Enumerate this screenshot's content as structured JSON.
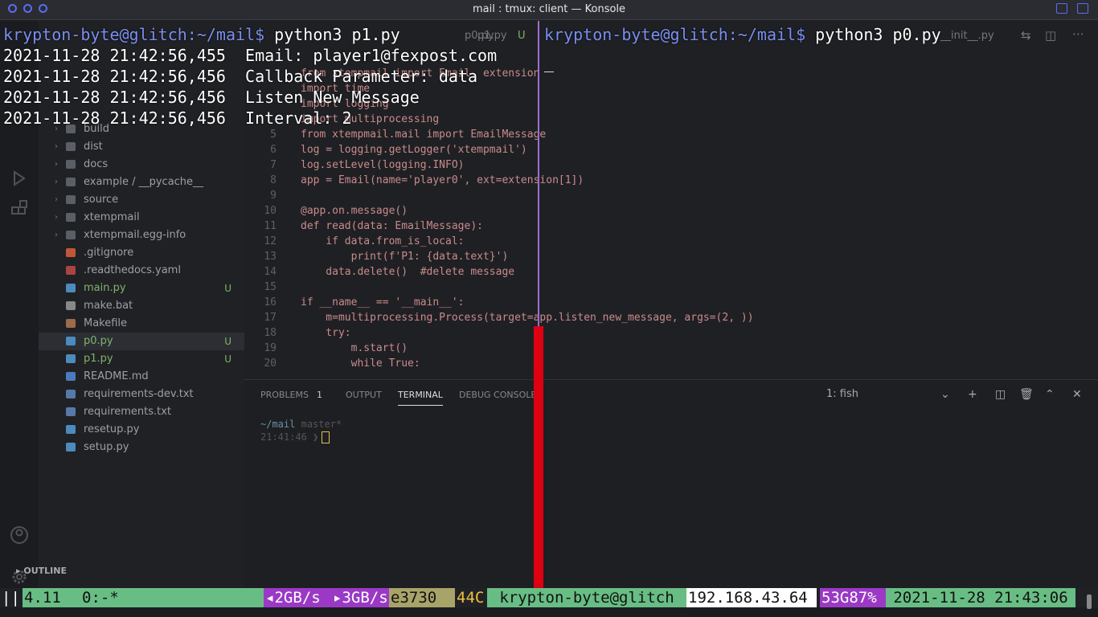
{
  "window": {
    "title": "mail : tmux: client — Konsole"
  },
  "colors": {
    "divider": "#9b6fd0",
    "status_green": "#68bd84",
    "status_purple": "#9b39c6",
    "status_khaki": "#a8a368",
    "status_white": "#ffffff",
    "cpu_temp_text": "#f0c040",
    "alert_red": "#dd0011"
  },
  "left_pane": {
    "prompt_user": "krypton-byte@glitch",
    "prompt_path": ":~/mail$",
    "command": " python3 p1.py",
    "logs": [
      {
        "timestamp": "2021-11-28 21:42:56,455",
        "message": "Email: player1@fexpost.com"
      },
      {
        "timestamp": "2021-11-28 21:42:56,456",
        "message": "Callback Parameter: data"
      },
      {
        "timestamp": "2021-11-28 21:42:56,456",
        "message": "Listen New Message"
      },
      {
        "timestamp": "2021-11-28 21:42:56,456",
        "message": "Interval: 2"
      }
    ]
  },
  "right_pane": {
    "prompt_user": "krypton-byte@glitch",
    "prompt_path": ":~/mail$",
    "command": " python3 p0.py",
    "cursor": "_"
  },
  "status_bar": {
    "session": "||",
    "version": "4.11",
    "window": "0:-*",
    "download": "◂2GB/s",
    "upload": "▸3GB/s",
    "cpu_model": "e3730",
    "cpu_temp": "44C",
    "host": "krypton-byte@glitch",
    "ip": "192.168.43.64",
    "mem": "53G87%",
    "datetime": "2021-11-28 21:43:06"
  },
  "vscode": {
    "editor_tabs": [
      "p0.py",
      "p1.py",
      "U",
      "__init__.py"
    ],
    "tree": [
      {
        "label": "build",
        "type": "folder",
        "badge": ""
      },
      {
        "label": "dist",
        "type": "folder",
        "badge": ""
      },
      {
        "label": "docs",
        "type": "folder",
        "badge": ""
      },
      {
        "label": "example / __pycache__",
        "type": "folder",
        "badge": ""
      },
      {
        "label": "source",
        "type": "folder",
        "badge": ""
      },
      {
        "label": "xtempmail",
        "type": "folder",
        "badge": ""
      },
      {
        "label": "xtempmail.egg-info",
        "type": "folder",
        "badge": ""
      },
      {
        "label": ".gitignore",
        "type": "git",
        "badge": ""
      },
      {
        "label": ".readthedocs.yaml",
        "type": "yaml",
        "badge": ""
      },
      {
        "label": "main.py",
        "type": "py",
        "badge": "U"
      },
      {
        "label": "make.bat",
        "type": "bat",
        "badge": ""
      },
      {
        "label": "Makefile",
        "type": "make",
        "badge": ""
      },
      {
        "label": "p0.py",
        "type": "py",
        "badge": "U"
      },
      {
        "label": "p1.py",
        "type": "py",
        "badge": "U"
      },
      {
        "label": "README.md",
        "type": "md",
        "badge": ""
      },
      {
        "label": "requirements-dev.txt",
        "type": "txt",
        "badge": ""
      },
      {
        "label": "requirements.txt",
        "type": "txt",
        "badge": ""
      },
      {
        "label": "resetup.py",
        "type": "py",
        "badge": ""
      },
      {
        "label": "setup.py",
        "type": "py",
        "badge": ""
      }
    ],
    "outline_label": "OUTLINE",
    "code": [
      {
        "ln": "",
        "text": "from xtempmail import Email, extension"
      },
      {
        "ln": "",
        "text": "import time"
      },
      {
        "ln": "",
        "text": "import logging"
      },
      {
        "ln": "",
        "text": "import multiprocessing"
      },
      {
        "ln": "5",
        "text": "from xtempmail.mail import EmailMessage"
      },
      {
        "ln": "6",
        "text": "log = logging.getLogger('xtempmail')"
      },
      {
        "ln": "7",
        "text": "log.setLevel(logging.INFO)"
      },
      {
        "ln": "8",
        "text": "app = Email(name='player0', ext=extension[1])"
      },
      {
        "ln": "9",
        "text": ""
      },
      {
        "ln": "10",
        "text": "@app.on.message()"
      },
      {
        "ln": "11",
        "text": "def read(data: EmailMessage):"
      },
      {
        "ln": "12",
        "text": "    if data.from_is_local:"
      },
      {
        "ln": "13",
        "text": "        print(f'P1: {data.text}')"
      },
      {
        "ln": "14",
        "text": "    data.delete()  #delete message"
      },
      {
        "ln": "15",
        "text": ""
      },
      {
        "ln": "16",
        "text": "if __name__ == '__main__':"
      },
      {
        "ln": "17",
        "text": "    m=multiprocessing.Process(target=app.listen_new_message, args=(2, ))"
      },
      {
        "ln": "18",
        "text": "    try:"
      },
      {
        "ln": "19",
        "text": "        m.start()"
      },
      {
        "ln": "20",
        "text": "        while True:"
      }
    ],
    "panel": {
      "tabs": [
        "PROBLEMS",
        "OUTPUT",
        "TERMINAL",
        "DEBUG CONSOLE"
      ],
      "problems_count": "1",
      "active_tab": "TERMINAL",
      "shell": "1: fish",
      "term_path": "~/mail",
      "term_branch": "master*",
      "term_time": "21:41:46 ❯"
    }
  }
}
